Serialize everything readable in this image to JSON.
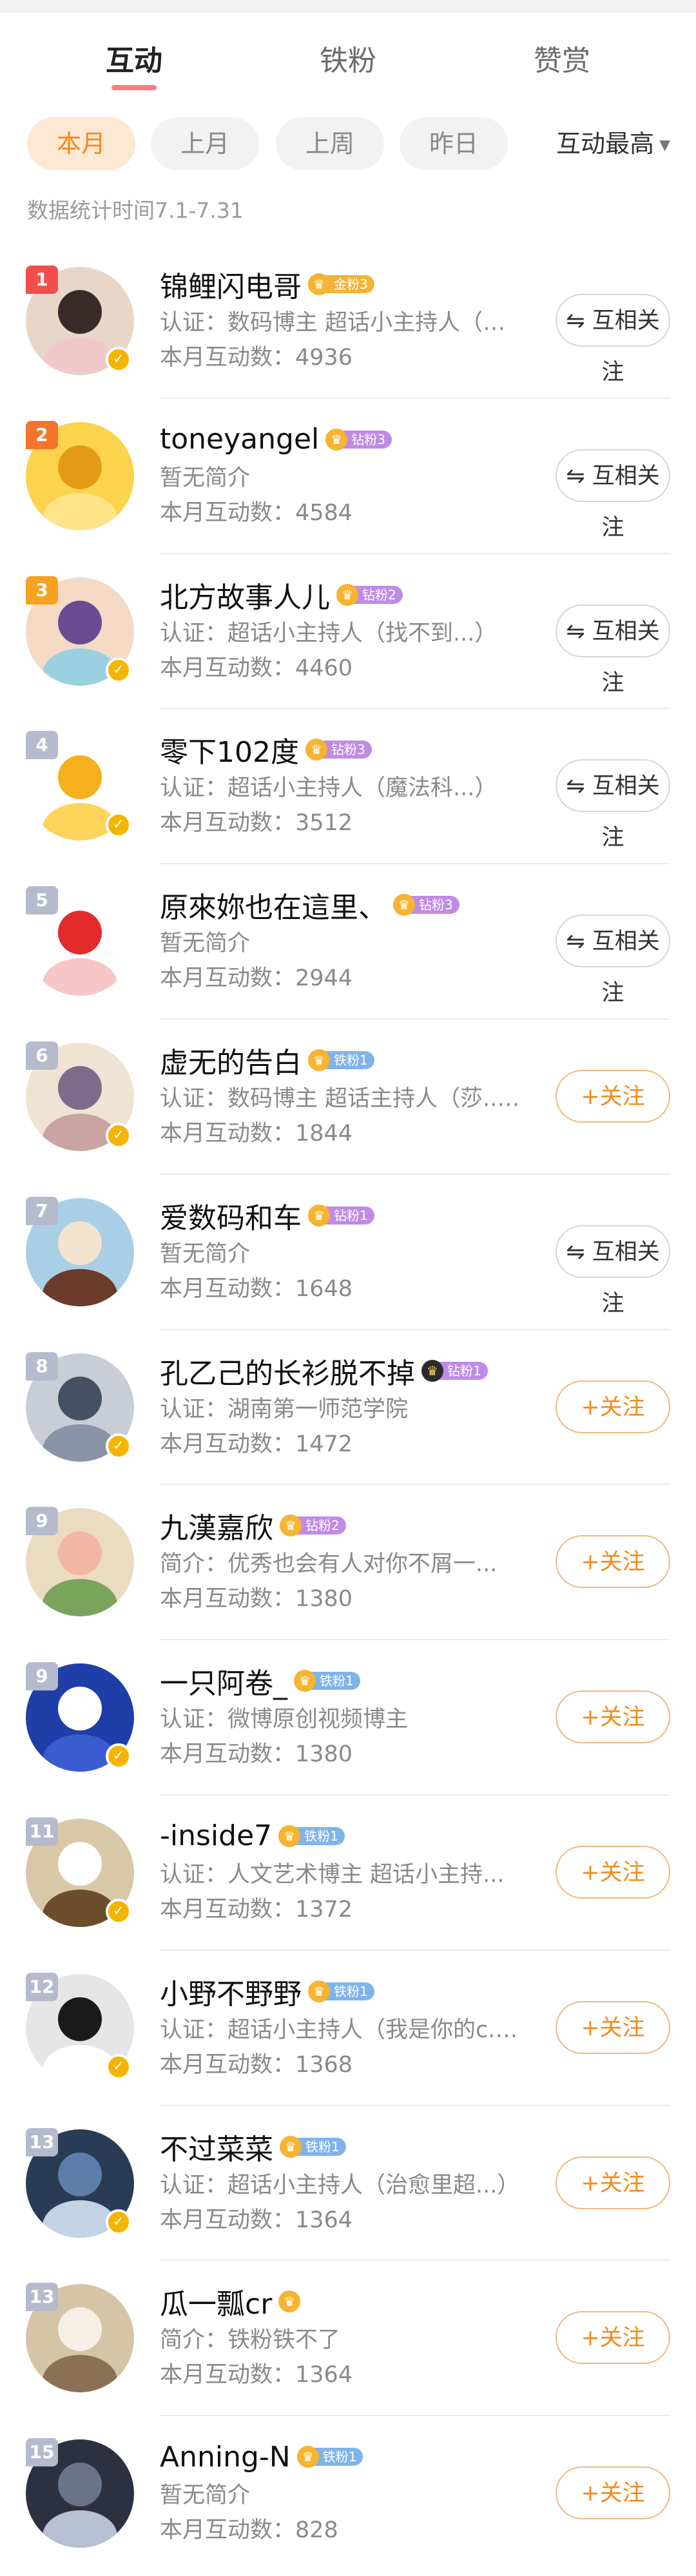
{
  "tabs": [
    {
      "label": "互动",
      "active": true
    },
    {
      "label": "铁粉",
      "active": false
    },
    {
      "label": "赞赏",
      "active": false
    }
  ],
  "filters": [
    {
      "label": "本月",
      "active": true
    },
    {
      "label": "上月",
      "active": false
    },
    {
      "label": "上周",
      "active": false
    },
    {
      "label": "昨日",
      "active": false
    }
  ],
  "sort": {
    "label": "互动最高",
    "icon": "caret-down-icon"
  },
  "stat_period": "数据统计时间7.1-7.31",
  "colors": {
    "accent": "#f28a1f",
    "tab_indicator": "#ff7a7a"
  },
  "buttons": {
    "mutual": "⇋ 互相关注",
    "follow": "+关注"
  },
  "users": [
    {
      "rank": "1",
      "name": "锦鲤闪电哥",
      "badge": "金粉3",
      "badge_type": "gold",
      "sub": "认证：数码博主 超话小主持人（找不到...）",
      "count": "本月互动数：4936",
      "button": "mutual",
      "verified": true
    },
    {
      "rank": "2",
      "name": "toneyangel",
      "badge": "钻粉3",
      "badge_type": "diamond",
      "sub": "暂无简介",
      "count": "本月互动数：4584",
      "button": "mutual",
      "verified": false
    },
    {
      "rank": "3",
      "name": "北方故事人儿",
      "badge": "钻粉2",
      "badge_type": "diamond",
      "sub": "认证：超话小主持人（找不到...）",
      "count": "本月互动数：4460",
      "button": "mutual",
      "verified": true
    },
    {
      "rank": "4",
      "name": "零下102度",
      "badge": "钻粉3",
      "badge_type": "diamond",
      "sub": "认证：超话小主持人（魔法科...）",
      "count": "本月互动数：3512",
      "button": "mutual",
      "verified": true
    },
    {
      "rank": "5",
      "name": "原來妳也在這里、",
      "badge": "钻粉3",
      "badge_type": "diamond",
      "sub": "暂无简介",
      "count": "本月互动数：2944",
      "button": "mutual",
      "verified": false
    },
    {
      "rank": "6",
      "name": "虚无的告白",
      "badge": "铁粉1",
      "badge_type": "iron",
      "sub": "认证：数码博主 超话主持人（莎...）",
      "count": "本月互动数：1844",
      "button": "follow",
      "verified": true
    },
    {
      "rank": "7",
      "name": "爱数码和车",
      "badge": "钻粉1",
      "badge_type": "diamond",
      "sub": "暂无简介",
      "count": "本月互动数：1648",
      "button": "mutual",
      "verified": false
    },
    {
      "rank": "8",
      "name": "孔乙己的长衫脱不掉",
      "badge": "钻粉1",
      "badge_type": "diamond",
      "sub": "认证：湖南第一师范学院",
      "count": "本月互动数：1472",
      "button": "follow",
      "verified": true,
      "dark_crown": true
    },
    {
      "rank": "9",
      "name": "九漢嘉欣",
      "badge": "钻粉2",
      "badge_type": "diamond",
      "sub": "简介：优秀也会有人对你不屑一...",
      "count": "本月互动数：1380",
      "button": "follow",
      "verified": false
    },
    {
      "rank": "9",
      "name": "一只阿卷_",
      "badge": "铁粉1",
      "badge_type": "iron",
      "sub": "认证：微博原创视频博主",
      "count": "本月互动数：1380",
      "button": "follow",
      "verified": true
    },
    {
      "rank": "11",
      "name": "-inside7",
      "badge": "铁粉1",
      "badge_type": "iron",
      "sub": "认证：人文艺术博主 超话小主持...",
      "count": "本月互动数：1372",
      "button": "follow",
      "verified": true
    },
    {
      "rank": "12",
      "name": "小野不野野",
      "badge": "铁粉1",
      "badge_type": "iron",
      "sub": "认证：超话小主持人（我是你的c...）",
      "count": "本月互动数：1368",
      "button": "follow",
      "verified": true
    },
    {
      "rank": "13",
      "name": "不过菜菜",
      "badge": "铁粉1",
      "badge_type": "iron",
      "sub": "认证：超话小主持人（治愈里超...）",
      "count": "本月互动数：1364",
      "button": "follow",
      "verified": true
    },
    {
      "rank": "13",
      "name": "瓜一瓢cr",
      "badge": "",
      "badge_type": "none",
      "sub": "简介：铁粉铁不了",
      "count": "本月互动数：1364",
      "button": "follow",
      "verified": false
    },
    {
      "rank": "15",
      "name": "Anning-N",
      "badge": "铁粉1",
      "badge_type": "iron",
      "sub": "暂无简介",
      "count": "本月互动数：828",
      "button": "follow",
      "verified": false
    }
  ]
}
